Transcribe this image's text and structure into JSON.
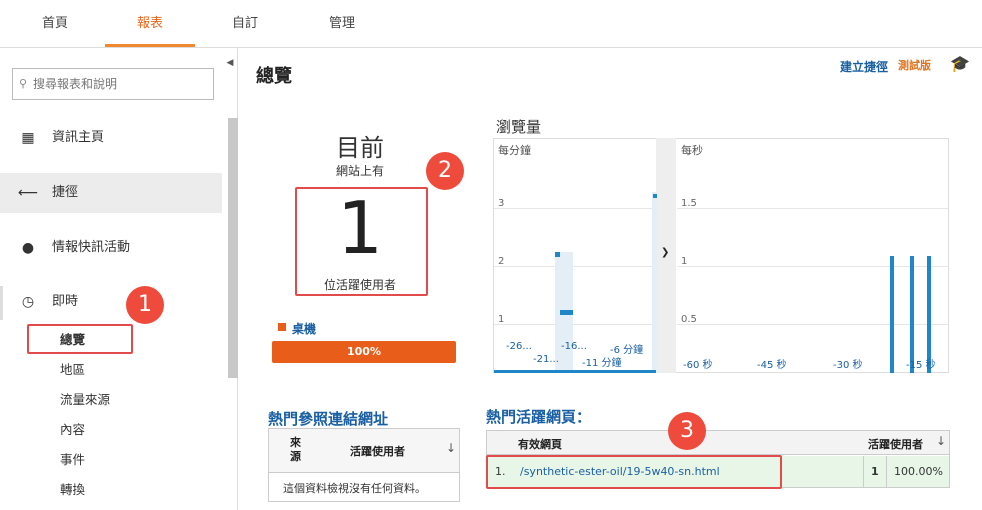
{
  "topnav": {
    "tabs": [
      {
        "label": "首頁"
      },
      {
        "label": "報表"
      },
      {
        "label": "自訂"
      },
      {
        "label": "管理"
      }
    ]
  },
  "sidebar": {
    "search_placeholder": "搜尋報表和說明",
    "items": [
      {
        "label": "資訊主頁"
      },
      {
        "label": "捷徑"
      },
      {
        "label": "情報快訊活動"
      },
      {
        "label": "即時"
      }
    ],
    "subitems": [
      {
        "label": "總覽"
      },
      {
        "label": "地區"
      },
      {
        "label": "流量來源"
      },
      {
        "label": "內容"
      },
      {
        "label": "事件"
      },
      {
        "label": "轉換"
      }
    ]
  },
  "header": {
    "title": "總覽",
    "shortcut_label": "建立捷徑",
    "beta_label": "測試版"
  },
  "summary": {
    "now_label": "目前",
    "onsite_label": "網站上有",
    "active_count": "1",
    "active_label": "位活躍使用者",
    "device": {
      "label": "桌機",
      "percent": "100%",
      "fraction": 1.0,
      "color": "#e85d1a"
    }
  },
  "pageviews": {
    "title": "瀏覽量",
    "per_minute": {
      "label": "每分鐘",
      "yticks": [
        "3",
        "2",
        "1"
      ],
      "xticks": [
        "-26...",
        "-21...",
        "-16...",
        "-11 分鐘",
        "-6 分鐘"
      ]
    },
    "per_second": {
      "label": "每秒",
      "yticks": [
        "1.5",
        "1",
        "0.5"
      ],
      "xticks": [
        "-60 秒",
        "-45 秒",
        "-30 秒",
        "-15 秒"
      ]
    }
  },
  "referrals": {
    "title": "熱門參照連結網址",
    "col_source": "來源",
    "col_users": "活躍使用者",
    "empty": "這個資料檢視沒有任何資料。"
  },
  "active_pages": {
    "title": "熱門活躍網頁：",
    "col_page": "有效網頁",
    "col_users": "活躍使用者",
    "rows": [
      {
        "index": "1.",
        "page": "/synthetic-ester-oil/19-5w40-sn.html",
        "users": "1",
        "percent": "100.00%"
      }
    ]
  },
  "annotations": {
    "b1": "1",
    "b2": "2",
    "b3": "3"
  },
  "colors": {
    "accent": "#e8661d",
    "link": "#1a5fa3",
    "highlight": "#e14b4b",
    "bar": "#1f86c8"
  }
}
